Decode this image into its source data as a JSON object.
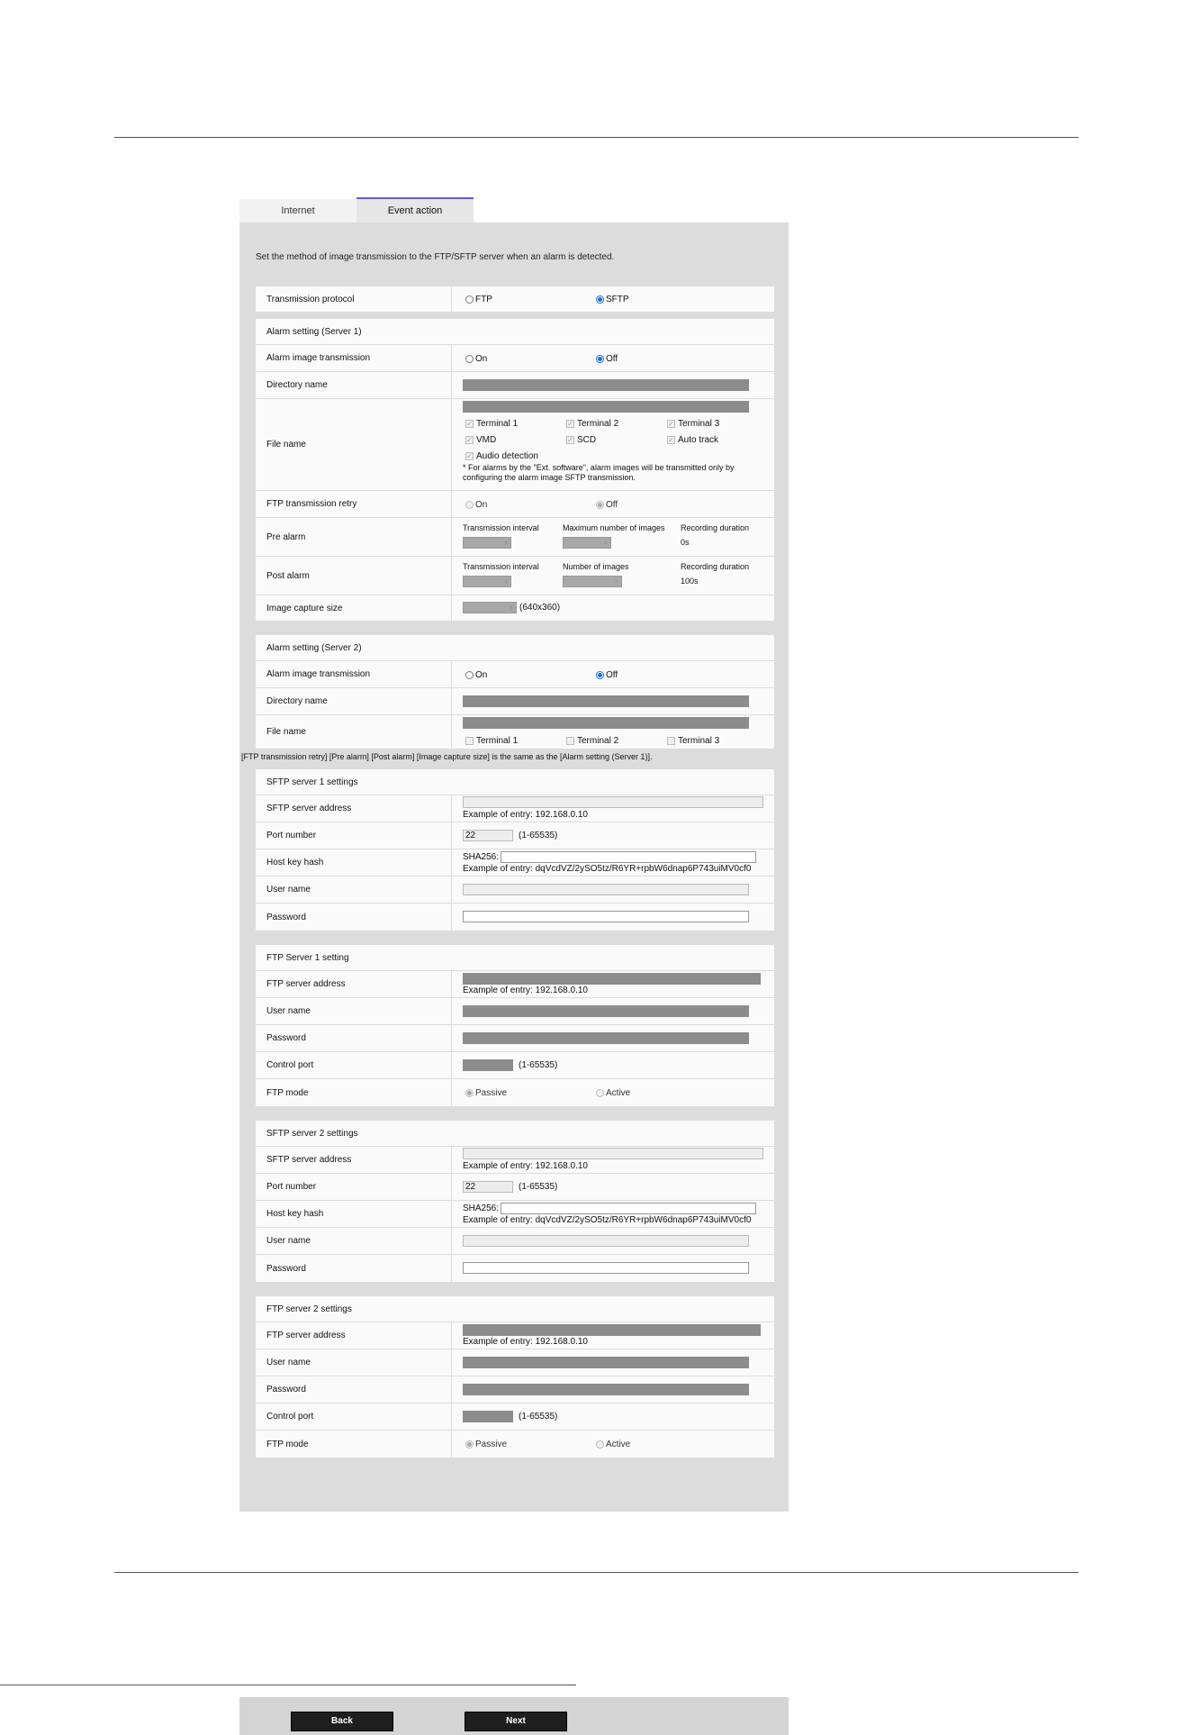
{
  "tabs": [
    {
      "label": "Internet"
    },
    {
      "label": "Event action"
    }
  ],
  "intro": "Set the method of image transmission to the FTP/SFTP server when an alarm is detected.",
  "protocol": {
    "label": "Transmission protocol",
    "ftp": "FTP",
    "sftp": "SFTP",
    "selected": "SFTP"
  },
  "server1": {
    "header": "Alarm setting (Server 1)",
    "alarm_label": "Alarm image transmission",
    "on": "On",
    "off": "Off",
    "dir_label": "Directory name",
    "file_label": "File name",
    "terminals": [
      "Terminal 1",
      "Terminal 2",
      "Terminal 3",
      "VMD",
      "SCD",
      "Auto track",
      "Audio detection"
    ],
    "file_note": "* For alarms by the \"Ext. software\", alarm images will be transmitted only by configuring the alarm image SFTP transmission.",
    "retry_label": "FTP transmission retry",
    "pre_label": "Pre alarm",
    "pre_cols": [
      "Transmission interval",
      "Maximum number of images",
      "Recording duration"
    ],
    "pre_duration": "0s",
    "post_label": "Post alarm",
    "post_cols": [
      "Transmission interval",
      "Number of images",
      "Recording duration"
    ],
    "post_duration": "100s",
    "capture_label": "Image capture size",
    "capture_value": "(640x360)"
  },
  "server2": {
    "header": "Alarm setting (Server 2)",
    "alarm_label": "Alarm image transmission",
    "on": "On",
    "off": "Off",
    "dir_label": "Directory name",
    "file_label": "File name",
    "terminals": [
      "Terminal 1",
      "Terminal 2",
      "Terminal 3"
    ]
  },
  "same_note": "[FTP transmission retry] [Pre alarm] [Post alarm] [Image capture size] is the same as the [Alarm setting (Server 1)].",
  "sftp1": {
    "header": "SFTP server 1 settings",
    "addr_label": "SFTP server address",
    "addr_example": "Example of entry: 192.168.0.10",
    "port_label": "Port number",
    "port_value": "22",
    "port_range": "(1-65535)",
    "hash_label": "Host key hash",
    "hash_prefix": "SHA256:",
    "hash_example": "Example of entry: dqVcdVZ/2ySO5tz/R6YR+rpbW6dnap6P743uiMV0cf0",
    "user_label": "User name",
    "pass_label": "Password"
  },
  "ftp1": {
    "header": "FTP Server 1 setting",
    "addr_label": "FTP server address",
    "addr_example": "Example of entry: 192.168.0.10",
    "user_label": "User name",
    "pass_label": "Password",
    "port_label": "Control port",
    "port_range": "(1-65535)",
    "mode_label": "FTP mode",
    "passive": "Passive",
    "active": "Active"
  },
  "sftp2": {
    "header": "SFTP server 2 settings",
    "addr_label": "SFTP server address",
    "addr_example": "Example of entry: 192.168.0.10",
    "port_label": "Port number",
    "port_value": "22",
    "port_range": "(1-65535)",
    "hash_label": "Host key hash",
    "hash_prefix": "SHA256:",
    "hash_example": "Example of entry: dqVcdVZ/2ySO5tz/R6YR+rpbW6dnap6P743uiMV0cf0",
    "user_label": "User name",
    "pass_label": "Password"
  },
  "ftp2": {
    "header": "FTP server 2 settings",
    "addr_label": "FTP server address",
    "addr_example": "Example of entry: 192.168.0.10",
    "user_label": "User name",
    "pass_label": "Password",
    "port_label": "Control port",
    "port_range": "(1-65535)",
    "mode_label": "FTP mode",
    "passive": "Passive",
    "active": "Active"
  },
  "buttons": {
    "back": "Back",
    "next": "Next"
  }
}
